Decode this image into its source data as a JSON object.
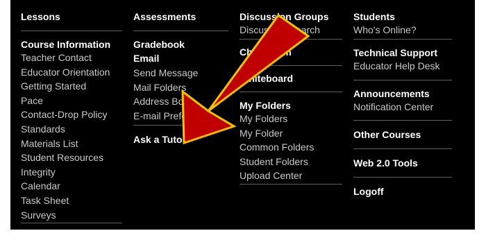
{
  "columns": [
    {
      "name": "lessons",
      "groups": [
        {
          "heading": "Lessons",
          "items": []
        },
        {
          "heading": "Course Information",
          "items": [
            "Teacher Contact",
            "Educator Orientation",
            "Getting Started",
            "Pace",
            "Contact-Drop Policy",
            "Standards",
            "Materials List",
            "Student Resources",
            "Integrity",
            "Calendar",
            "Task Sheet",
            "Surveys"
          ]
        }
      ]
    },
    {
      "name": "assessments",
      "groups": [
        {
          "heading": "Assessments",
          "items": []
        },
        {
          "heading": "Gradebook",
          "items": []
        },
        {
          "heading": "Email",
          "items": [
            "Send Message",
            "Mail Folders",
            "Address Book",
            "E-mail Preferences"
          ]
        },
        {
          "heading": "Ask a Tutor",
          "items": []
        }
      ]
    },
    {
      "name": "discussion",
      "groups": [
        {
          "heading": "Discussion Groups",
          "items": [
            "Discussion Search"
          ]
        },
        {
          "heading": "Chat Room",
          "items": []
        },
        {
          "heading": "Whiteboard",
          "items": []
        },
        {
          "heading": "My Folders",
          "items": [
            "My Folders",
            "My Folder",
            "Common Folders",
            "Student Folders",
            "Upload Center"
          ]
        }
      ]
    },
    {
      "name": "students",
      "groups": [
        {
          "heading": "Students",
          "items": [
            "Who's Online?"
          ]
        },
        {
          "heading": "Technical Support",
          "items": [
            "Educator Help Desk"
          ]
        },
        {
          "heading": "Announcements",
          "items": [
            "Notification Center"
          ]
        },
        {
          "heading": "Other Courses",
          "items": []
        },
        {
          "heading": "Web 2.0 Tools",
          "items": []
        },
        {
          "heading": "Logoff",
          "items": []
        }
      ]
    }
  ],
  "colors": {
    "background": "#000000",
    "heading": "#ffffff",
    "link": "#c9c9c9",
    "arrow_fill": "#c00000",
    "arrow_outline": "#f2c200"
  },
  "annotation": {
    "icon": "arrow-icon"
  }
}
